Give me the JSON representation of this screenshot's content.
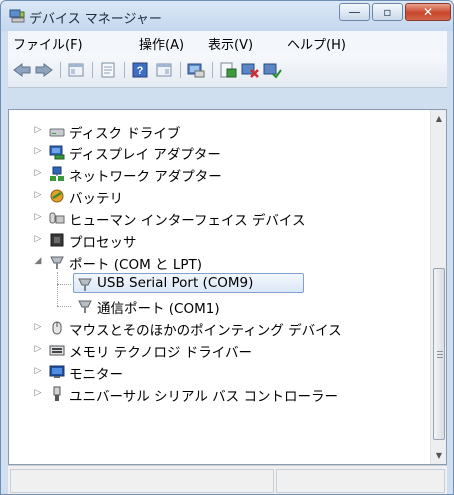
{
  "window": {
    "title": "デバイス マネージャー"
  },
  "caption": {
    "minimize": "—",
    "maximize": "▫",
    "close": "✕"
  },
  "menu": [
    "ファイル(F)",
    "操作(A)",
    "表示(V)",
    "ヘルプ(H)"
  ],
  "toolbar": {
    "buttons": [
      "back-icon",
      "forward-icon",
      "show-hide-tree-icon",
      "properties-icon",
      "help-icon",
      "view-icon",
      "scan-hardware-icon",
      "update-driver-icon",
      "uninstall-icon",
      "disable-icon"
    ]
  },
  "tree": {
    "items": [
      {
        "label": "ディスク ドライブ",
        "icon": "disk-drive-icon",
        "expanded": false
      },
      {
        "label": "ディスプレイ アダプター",
        "icon": "display-adapter-icon",
        "expanded": false
      },
      {
        "label": "ネットワーク アダプター",
        "icon": "network-adapter-icon",
        "expanded": false
      },
      {
        "label": "バッテリ",
        "icon": "battery-icon",
        "expanded": false
      },
      {
        "label": "ヒューマン インターフェイス デバイス",
        "icon": "hid-icon",
        "expanded": false
      },
      {
        "label": "プロセッサ",
        "icon": "processor-icon",
        "expanded": false
      },
      {
        "label": "ポート (COM と LPT)",
        "icon": "port-icon",
        "expanded": true,
        "children": [
          {
            "label": "USB Serial Port (COM9)",
            "icon": "port-icon",
            "selected": true
          },
          {
            "label": "通信ポート (COM1)",
            "icon": "port-icon",
            "selected": false
          }
        ]
      },
      {
        "label": "マウスとそのほかのポインティング デバイス",
        "icon": "mouse-icon",
        "expanded": false
      },
      {
        "label": "メモリ テクノロジ ドライバー",
        "icon": "memory-icon",
        "expanded": false
      },
      {
        "label": "モニター",
        "icon": "monitor-icon",
        "expanded": false
      },
      {
        "label": "ユニバーサル シリアル バス コントローラー",
        "icon": "usb-icon",
        "expanded": false
      }
    ]
  },
  "scrollbar": {
    "up": "▲",
    "down": "▼"
  },
  "expander": {
    "collapsed": "▷",
    "expanded": "◢"
  }
}
